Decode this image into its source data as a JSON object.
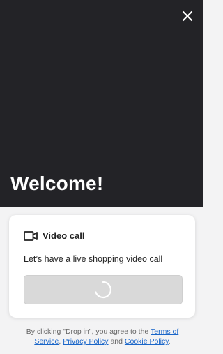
{
  "hero": {
    "title": "Welcome!",
    "background_color": "#232327",
    "close_icon": "close-icon"
  },
  "card": {
    "icon": "video-camera-icon",
    "title": "Video call",
    "description": "Let’s have a live shopping video call",
    "button_state": "loading"
  },
  "legal": {
    "prefix": "By clicking \"Drop in\", you agree to the ",
    "terms_link": "Terms of Service",
    "separator": ", ",
    "privacy_link": "Privacy Policy",
    "and": " and ",
    "cookie_link": "Cookie Policy",
    "suffix": ".",
    "link_color": "#1a66c9"
  }
}
